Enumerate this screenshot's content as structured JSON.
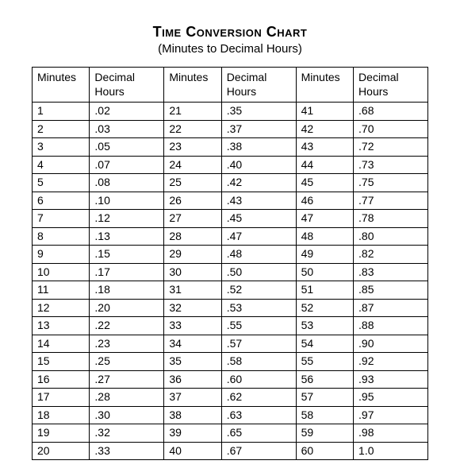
{
  "title": "Time Conversion Chart",
  "subtitle": "(Minutes to Decimal Hours)",
  "headers": {
    "minutes": "Minutes",
    "decimal": "Decimal Hours"
  },
  "columns": [
    [
      {
        "m": "1",
        "d": ".02"
      },
      {
        "m": "2",
        "d": ".03"
      },
      {
        "m": "3",
        "d": ".05"
      },
      {
        "m": "4",
        "d": ".07"
      },
      {
        "m": "5",
        "d": ".08"
      },
      {
        "m": "6",
        "d": ".10"
      },
      {
        "m": "7",
        "d": ".12"
      },
      {
        "m": "8",
        "d": ".13"
      },
      {
        "m": "9",
        "d": ".15"
      },
      {
        "m": "10",
        "d": ".17"
      },
      {
        "m": "11",
        "d": ".18"
      },
      {
        "m": "12",
        "d": ".20"
      },
      {
        "m": "13",
        "d": ".22"
      },
      {
        "m": "14",
        "d": ".23"
      },
      {
        "m": "15",
        "d": ".25"
      },
      {
        "m": "16",
        "d": ".27"
      },
      {
        "m": "17",
        "d": ".28"
      },
      {
        "m": "18",
        "d": ".30"
      },
      {
        "m": "19",
        "d": ".32"
      },
      {
        "m": "20",
        "d": ".33"
      }
    ],
    [
      {
        "m": "21",
        "d": ".35"
      },
      {
        "m": "22",
        "d": ".37"
      },
      {
        "m": "23",
        "d": ".38"
      },
      {
        "m": "24",
        "d": ".40"
      },
      {
        "m": "25",
        "d": ".42"
      },
      {
        "m": "26",
        "d": ".43"
      },
      {
        "m": "27",
        "d": ".45"
      },
      {
        "m": "28",
        "d": ".47"
      },
      {
        "m": "29",
        "d": ".48"
      },
      {
        "m": "30",
        "d": ".50"
      },
      {
        "m": "31",
        "d": ".52"
      },
      {
        "m": "32",
        "d": ".53"
      },
      {
        "m": "33",
        "d": ".55"
      },
      {
        "m": "34",
        "d": ".57"
      },
      {
        "m": "35",
        "d": ".58"
      },
      {
        "m": "36",
        "d": ".60"
      },
      {
        "m": "37",
        "d": ".62"
      },
      {
        "m": "38",
        "d": ".63"
      },
      {
        "m": "39",
        "d": ".65"
      },
      {
        "m": "40",
        "d": ".67"
      }
    ],
    [
      {
        "m": "41",
        "d": ".68"
      },
      {
        "m": "42",
        "d": ".70"
      },
      {
        "m": "43",
        "d": ".72"
      },
      {
        "m": "44",
        "d": ".73"
      },
      {
        "m": "45",
        "d": ".75"
      },
      {
        "m": "46",
        "d": ".77"
      },
      {
        "m": "47",
        "d": ".78"
      },
      {
        "m": "48",
        "d": ".80"
      },
      {
        "m": "49",
        "d": ".82"
      },
      {
        "m": "50",
        "d": ".83"
      },
      {
        "m": "51",
        "d": ".85"
      },
      {
        "m": "52",
        "d": ".87"
      },
      {
        "m": "53",
        "d": ".88"
      },
      {
        "m": "54",
        "d": ".90"
      },
      {
        "m": "55",
        "d": ".92"
      },
      {
        "m": "56",
        "d": ".93"
      },
      {
        "m": "57",
        "d": ".95"
      },
      {
        "m": "58",
        "d": ".97"
      },
      {
        "m": "59",
        "d": ".98"
      },
      {
        "m": "60",
        "d": "1.0"
      }
    ]
  ],
  "chart_data": {
    "type": "table",
    "title": "Time Conversion Chart (Minutes to Decimal Hours)",
    "columns": [
      "Minutes",
      "Decimal Hours"
    ],
    "rows": [
      [
        1,
        0.02
      ],
      [
        2,
        0.03
      ],
      [
        3,
        0.05
      ],
      [
        4,
        0.07
      ],
      [
        5,
        0.08
      ],
      [
        6,
        0.1
      ],
      [
        7,
        0.12
      ],
      [
        8,
        0.13
      ],
      [
        9,
        0.15
      ],
      [
        10,
        0.17
      ],
      [
        11,
        0.18
      ],
      [
        12,
        0.2
      ],
      [
        13,
        0.22
      ],
      [
        14,
        0.23
      ],
      [
        15,
        0.25
      ],
      [
        16,
        0.27
      ],
      [
        17,
        0.28
      ],
      [
        18,
        0.3
      ],
      [
        19,
        0.32
      ],
      [
        20,
        0.33
      ],
      [
        21,
        0.35
      ],
      [
        22,
        0.37
      ],
      [
        23,
        0.38
      ],
      [
        24,
        0.4
      ],
      [
        25,
        0.42
      ],
      [
        26,
        0.43
      ],
      [
        27,
        0.45
      ],
      [
        28,
        0.47
      ],
      [
        29,
        0.48
      ],
      [
        30,
        0.5
      ],
      [
        31,
        0.52
      ],
      [
        32,
        0.53
      ],
      [
        33,
        0.55
      ],
      [
        34,
        0.57
      ],
      [
        35,
        0.58
      ],
      [
        36,
        0.6
      ],
      [
        37,
        0.62
      ],
      [
        38,
        0.63
      ],
      [
        39,
        0.65
      ],
      [
        40,
        0.67
      ],
      [
        41,
        0.68
      ],
      [
        42,
        0.7
      ],
      [
        43,
        0.72
      ],
      [
        44,
        0.73
      ],
      [
        45,
        0.75
      ],
      [
        46,
        0.77
      ],
      [
        47,
        0.78
      ],
      [
        48,
        0.8
      ],
      [
        49,
        0.82
      ],
      [
        50,
        0.83
      ],
      [
        51,
        0.85
      ],
      [
        52,
        0.87
      ],
      [
        53,
        0.88
      ],
      [
        54,
        0.9
      ],
      [
        55,
        0.92
      ],
      [
        56,
        0.93
      ],
      [
        57,
        0.95
      ],
      [
        58,
        0.97
      ],
      [
        59,
        0.98
      ],
      [
        60,
        1.0
      ]
    ]
  }
}
